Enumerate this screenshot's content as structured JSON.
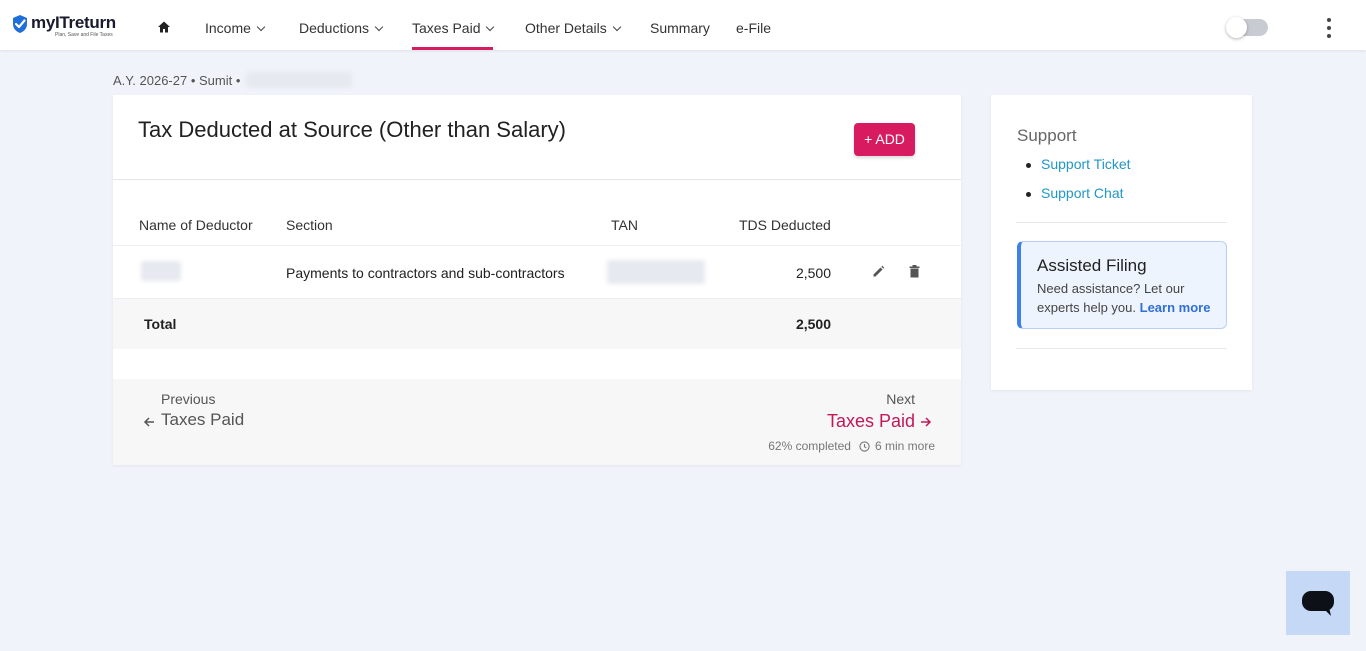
{
  "brand": {
    "name": "myITreturn",
    "tagline": "Plan, Save and File Taxes",
    "accent": "#d81b60",
    "check_color": "#1e6fd9"
  },
  "nav": {
    "home_icon": "home-icon",
    "items": [
      {
        "label": "Income",
        "has_dropdown": true,
        "active": false
      },
      {
        "label": "Deductions",
        "has_dropdown": true,
        "active": false
      },
      {
        "label": "Taxes Paid",
        "has_dropdown": true,
        "active": true
      },
      {
        "label": "Other Details",
        "has_dropdown": true,
        "active": false
      },
      {
        "label": "Summary",
        "has_dropdown": false,
        "active": false
      },
      {
        "label": "e-File",
        "has_dropdown": false,
        "active": false
      }
    ],
    "toggle_on": false,
    "more_icon": "more-vertical-icon"
  },
  "breadcrumb": {
    "text": "A.Y. 2026-27 • Sumit •"
  },
  "card": {
    "title": "Tax Deducted at Source (Other than Salary)",
    "add_label": "+ ADD",
    "table": {
      "headers": [
        "Name of Deductor",
        "Section",
        "TAN",
        "TDS Deducted"
      ],
      "rows": [
        {
          "section": "Payments to contractors and sub-contractors",
          "tds": "2,500"
        }
      ],
      "total_label": "Total",
      "total_value": "2,500"
    },
    "footer": {
      "prev_label": "Previous",
      "prev_link": "Taxes Paid",
      "next_label": "Next",
      "next_link": "Taxes Paid",
      "progress": "62% completed",
      "time_left": "6 min more"
    }
  },
  "side": {
    "support_title": "Support",
    "support_links": [
      "Support Ticket",
      "Support Chat"
    ],
    "assist_title": "Assisted Filing",
    "assist_text": "Need assistance? Let our experts help you.",
    "assist_link": "Learn more"
  },
  "chat": {
    "icon": "chat-icon"
  }
}
